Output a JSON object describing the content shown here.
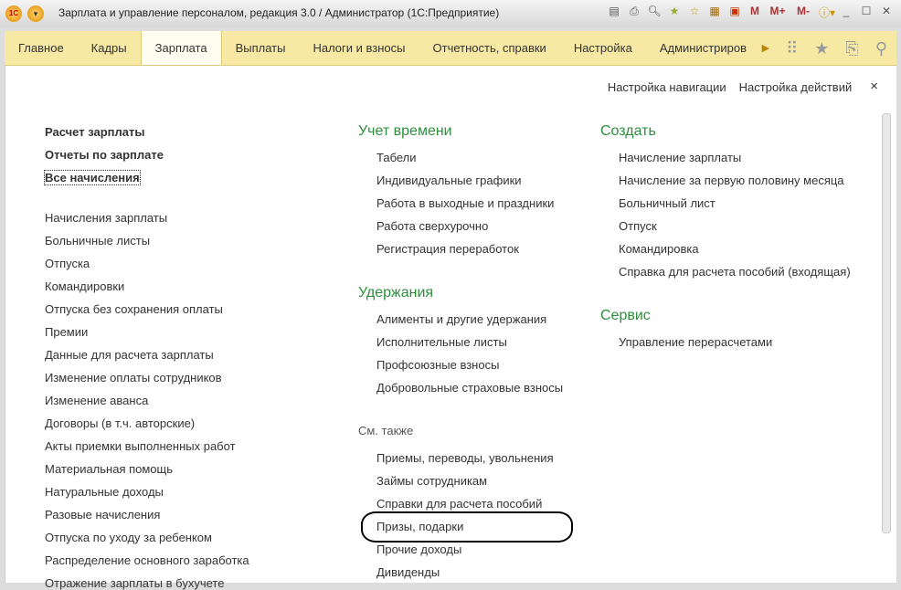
{
  "window": {
    "title": "Зарплата и управление персоналом, редакция 3.0 / Администратор  (1С:Предприятие)",
    "toolbar": [
      "save-icon",
      "print-icon",
      "preview-icon",
      "favorites-add-icon",
      "favorites-icon",
      "calculator-icon",
      "calendar-icon",
      "M",
      "M+",
      "M-",
      "info-icon",
      "minimize-icon",
      "maximize-icon",
      "close-icon"
    ],
    "toolbar_labels": {
      "m": "M",
      "mplus": "M+",
      "mminus": "M-"
    }
  },
  "nav": {
    "tabs": [
      "Главное",
      "Кадры",
      "Зарплата",
      "Выплаты",
      "Налоги и взносы",
      "Отчетность, справки",
      "Настройка",
      "Администриров"
    ],
    "active": "Зарплата"
  },
  "top_links": {
    "nav_settings": "Настройка навигации",
    "action_settings": "Настройка действий",
    "close": "×"
  },
  "left": {
    "bold": [
      "Расчет зарплаты",
      "Отчеты по зарплате",
      "Все начисления"
    ],
    "items": [
      "Начисления зарплаты",
      "Больничные листы",
      "Отпуска",
      "Командировки",
      "Отпуска без сохранения оплаты",
      "Премии",
      "Данные для расчета зарплаты",
      "Изменение оплаты сотрудников",
      "Изменение аванса",
      "Договоры (в т.ч. авторские)",
      "Акты приемки выполненных работ",
      "Материальная помощь",
      "Натуральные доходы",
      "Разовые начисления",
      "Отпуска по уходу за ребенком",
      "Распределение основного заработка",
      "Отражение зарплаты в бухучете"
    ]
  },
  "middle": {
    "time": {
      "title": "Учет времени",
      "items": [
        "Табели",
        "Индивидуальные графики",
        "Работа в выходные и праздники",
        "Работа сверхурочно",
        "Регистрация переработок"
      ]
    },
    "deductions": {
      "title": "Удержания",
      "items": [
        "Алименты и другие удержания",
        "Исполнительные листы",
        "Профсоюзные взносы",
        "Добровольные страховые взносы"
      ]
    },
    "see_also": {
      "title": "См. также",
      "items": [
        "Приемы, переводы, увольнения",
        "Займы сотрудникам",
        "Справки для расчета пособий",
        "Призы, подарки",
        "Прочие доходы",
        "Дивиденды"
      ]
    }
  },
  "right": {
    "create": {
      "title": "Создать",
      "items": [
        "Начисление зарплаты",
        "Начисление за первую половину месяца",
        "Больничный лист",
        "Отпуск",
        "Командировка",
        "Справка для расчета пособий (входящая)"
      ]
    },
    "service": {
      "title": "Сервис",
      "items": [
        "Управление перерасчетами"
      ]
    }
  }
}
